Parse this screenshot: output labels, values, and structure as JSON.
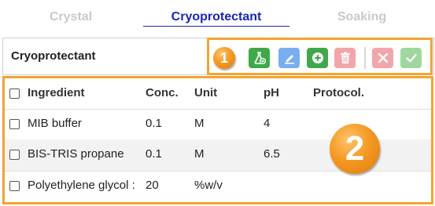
{
  "tabs": [
    {
      "label": "Crystal",
      "active": false
    },
    {
      "label": "Cryoprotectant",
      "active": true
    },
    {
      "label": "Soaking",
      "active": false
    }
  ],
  "panel": {
    "title": "Cryoprotectant"
  },
  "toolbar": {
    "buttons": [
      {
        "name": "add-ingredient",
        "icon": "flask-plus-icon",
        "color": "#3fa94a"
      },
      {
        "name": "edit",
        "icon": "pencil-icon",
        "color": "#78aef0"
      },
      {
        "name": "add",
        "icon": "plus-circle-icon",
        "color": "#3fa94a"
      },
      {
        "name": "delete",
        "icon": "trash-icon",
        "color": "#f2a5ab"
      },
      {
        "name": "cancel",
        "icon": "close-icon",
        "color": "#f2a5ab"
      },
      {
        "name": "confirm",
        "icon": "check-icon",
        "color": "#9fd79f"
      }
    ]
  },
  "annotations": {
    "badge_1": "1",
    "badge_2": "2",
    "highlight_color": "#f2a531"
  },
  "table": {
    "columns": [
      "Ingredient",
      "Conc.",
      "Unit",
      "pH",
      "Protocol."
    ],
    "rows": [
      {
        "ingredient": "MIB buffer",
        "conc": "0.1",
        "unit": "M",
        "ph": "4",
        "protocol": ""
      },
      {
        "ingredient": "BIS-TRIS propane",
        "conc": "0.1",
        "unit": "M",
        "ph": "6.5",
        "protocol": ""
      },
      {
        "ingredient": "Polyethylene glycol :",
        "conc": "20",
        "unit": "%w/v",
        "ph": "",
        "protocol": ""
      }
    ]
  },
  "colors": {
    "active_tab": "#1a24b8",
    "inactive_tab": "#c9c9c9"
  }
}
